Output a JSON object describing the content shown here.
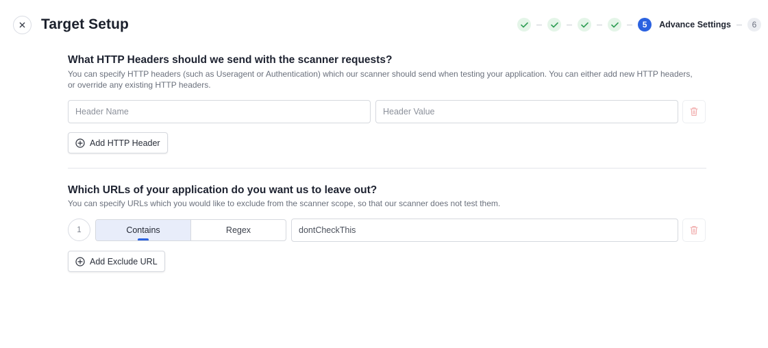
{
  "header": {
    "title": "Target Setup",
    "close_icon": "close-icon"
  },
  "stepper": {
    "completed_steps": 4,
    "active_step_number": "5",
    "active_step_label": "Advance Settings",
    "next_step_number": "6",
    "colors": {
      "done_bg": "#e4f5e8",
      "done_check": "#2f9e55",
      "active": "#2b62e0"
    }
  },
  "headers_section": {
    "heading": "What HTTP Headers should we send with the scanner requests?",
    "description": "You can specify HTTP headers (such as Useragent or Authentication) which our scanner should send when testing your application. You can either add new HTTP headers, or override any existing HTTP headers.",
    "name_placeholder": "Header Name",
    "value_placeholder": "Header Value",
    "add_label": "Add HTTP Header"
  },
  "exclude_section": {
    "heading": "Which URLs of your application do you want us to leave out?",
    "description": "You can specify URLs which you would like to exclude from the scanner scope, so that our scanner does not test them.",
    "rows": [
      {
        "index": "1",
        "match_options": [
          "Contains",
          "Regex"
        ],
        "selected": "Contains",
        "value": "dontCheckThis"
      }
    ],
    "add_label": "Add Exclude URL"
  },
  "colors": {
    "trash": "#f0a8a8",
    "accent": "#2b62e0"
  }
}
